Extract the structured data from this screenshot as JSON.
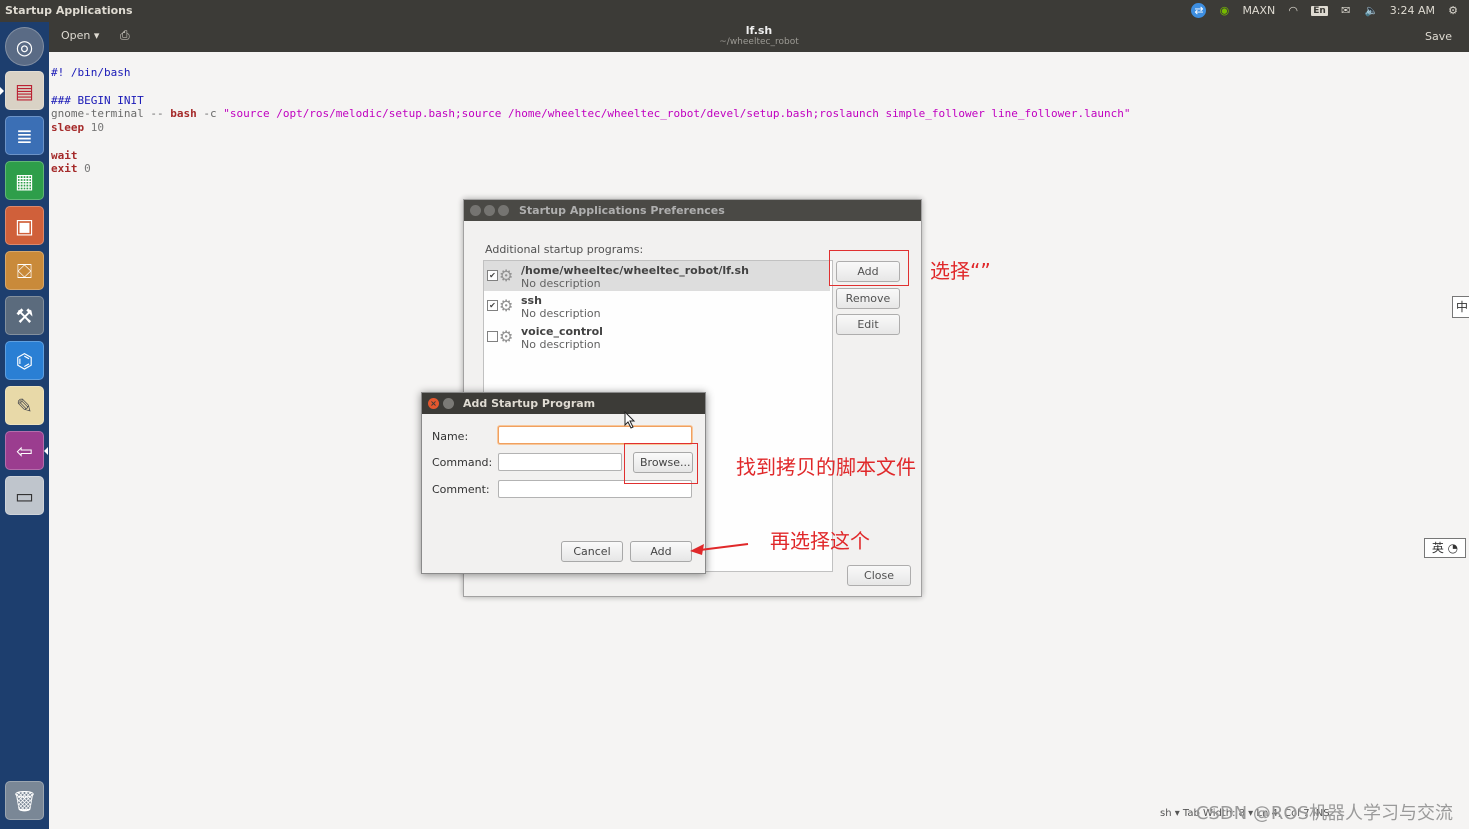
{
  "top_panel": {
    "app_title": "Startup Applications",
    "indicators": {
      "nvidia_mode": "MAXN",
      "keyboard": "En",
      "time": "3:24 AM"
    }
  },
  "launcher": {
    "items": [
      "ubuntu-dash-icon",
      "files-icon",
      "writer-icon",
      "calc-icon",
      "impress-icon",
      "software-center-icon",
      "system-settings-icon",
      "vscode-icon",
      "text-editor-icon",
      "startup-applications-icon",
      "drive-icon",
      "trash-icon"
    ]
  },
  "gedit": {
    "open_label": "Open",
    "doc_title": "lf.sh",
    "doc_path": "~/wheeltec_robot",
    "save_label": "Save",
    "code": {
      "line1": "#! /bin/bash",
      "line2": "### BEGIN INIT",
      "line3_cmd": "gnome-terminal",
      "line3_sep": " -- ",
      "line3_bash": "bash",
      "line3_flag": " -c ",
      "line3_str": "\"source /opt/ros/melodic/setup.bash;source /home/wheeltec/wheeltec_robot/devel/setup.bash;roslaunch simple_follower line_follower.launch\"",
      "line4_kw": "sleep",
      "line4_num": " 10",
      "line5_kw": "wait",
      "line6_kw": "exit",
      "line6_num": " 0"
    },
    "status": "sh ▾   Tab Width: 8 ▾   Ln 4, Col 7   INS"
  },
  "prefs_dialog": {
    "title": "Startup Applications Preferences",
    "section_label": "Additional startup programs:",
    "programs": [
      {
        "name": "/home/wheeltec/wheeltec_robot/lf.sh",
        "desc": "No description",
        "checked": true
      },
      {
        "name": "ssh",
        "desc": "No description",
        "checked": true
      },
      {
        "name": "voice_control",
        "desc": "No description",
        "checked": false
      }
    ],
    "add_label": "Add",
    "remove_label": "Remove",
    "edit_label": "Edit",
    "close_label": "Close"
  },
  "add_dialog": {
    "title": "Add Startup Program",
    "name_label": "Name:",
    "command_label": "Command:",
    "comment_label": "Comment:",
    "browse_label": "Browse...",
    "cancel_label": "Cancel",
    "add_label": "Add",
    "name_value": "",
    "command_value": "",
    "comment_value": ""
  },
  "annotations": {
    "note_add": "选择“”",
    "note_browse": "找到拷贝的脚本文件",
    "note_confirm": "再选择这个",
    "accent": "#e0282a"
  },
  "ime": {
    "zh": "中",
    "en": "英"
  },
  "watermark": "CSDN @ROS机器人学习与交流"
}
